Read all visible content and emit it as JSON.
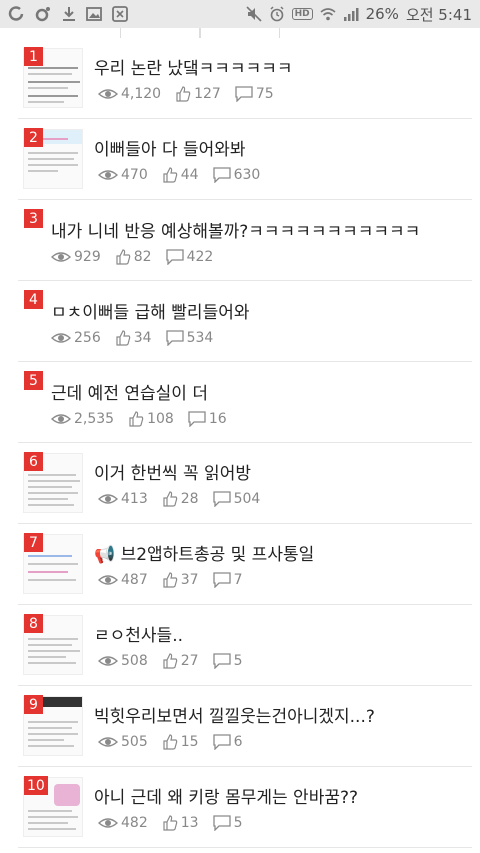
{
  "status_bar": {
    "battery_percent": "26%",
    "time": "오전 5:41",
    "hd_label": "HD"
  },
  "posts": [
    {
      "rank": "1",
      "title": "우리 논란 났댘ㅋㅋㅋㅋㅋㅋ",
      "views": "4,120",
      "likes": "127",
      "comments": "75",
      "has_thumb": true
    },
    {
      "rank": "2",
      "title": "이뻐들아 다 들어와봐",
      "views": "470",
      "likes": "44",
      "comments": "630",
      "has_thumb": true
    },
    {
      "rank": "3",
      "title": "내가 니네 반응 예상해볼까?ㅋㅋㅋㅋㅋㅋㅋㅋㅋㅋㅋ",
      "views": "929",
      "likes": "82",
      "comments": "422",
      "has_thumb": false
    },
    {
      "rank": "4",
      "title": "ㅁㅊ이뻐들 급해 빨리들어와",
      "views": "256",
      "likes": "34",
      "comments": "534",
      "has_thumb": false
    },
    {
      "rank": "5",
      "title": "근데 예전 연습실이 더",
      "views": "2,535",
      "likes": "108",
      "comments": "16",
      "has_thumb": false
    },
    {
      "rank": "6",
      "title": "이거 한번씩 꼭 읽어방",
      "views": "413",
      "likes": "28",
      "comments": "504",
      "has_thumb": true
    },
    {
      "rank": "7",
      "title": "📢 브2앱하트총공 및 프사통일",
      "views": "487",
      "likes": "37",
      "comments": "7",
      "has_thumb": true
    },
    {
      "rank": "8",
      "title": "ㄹㅇ천사들..",
      "views": "508",
      "likes": "27",
      "comments": "5",
      "has_thumb": true
    },
    {
      "rank": "9",
      "title": "빅힛우리보면서 낄낄웃는건아니겠지...?",
      "views": "505",
      "likes": "15",
      "comments": "6",
      "has_thumb": true
    },
    {
      "rank": "10",
      "title": "아니 근데 왜 키랑 몸무게는 안바꿈??",
      "views": "482",
      "likes": "13",
      "comments": "5",
      "has_thumb": true
    }
  ]
}
